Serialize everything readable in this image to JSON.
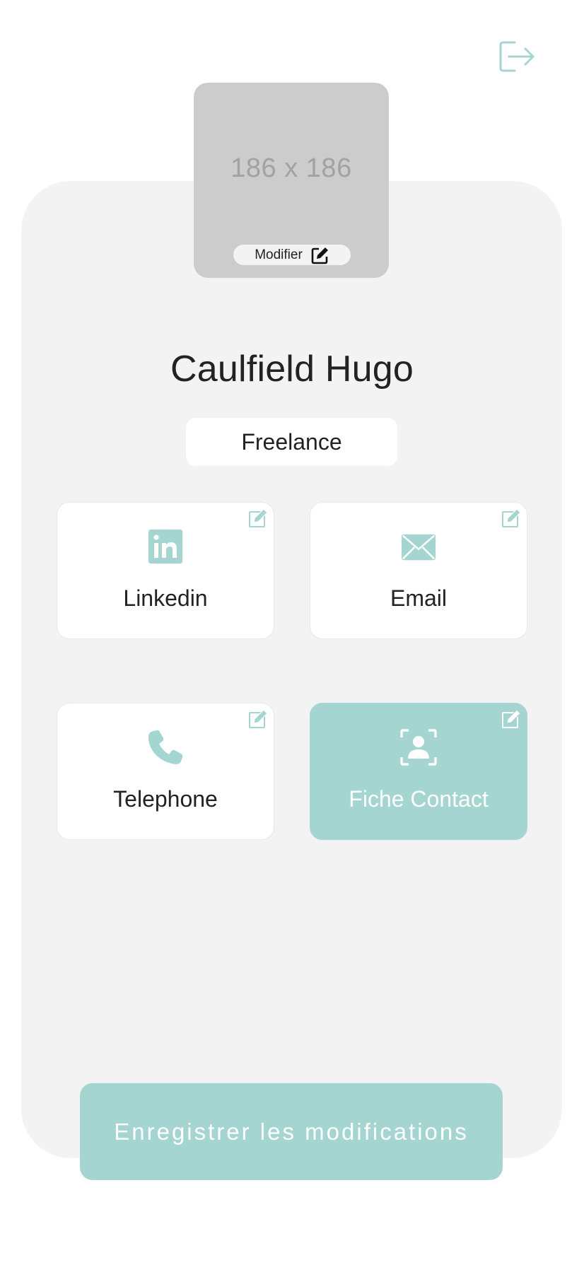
{
  "colors": {
    "accent": "#a5d5d1",
    "card_bg": "#f3f3f3",
    "placeholder_bg": "#cccccc",
    "text": "#222222"
  },
  "header": {
    "logout_icon": "logout-icon"
  },
  "profile": {
    "avatar_placeholder": "186 x 186",
    "modify_label": "Modifier",
    "name": "Caulfield Hugo",
    "status": "Freelance"
  },
  "tiles": [
    {
      "label": "Linkedin",
      "icon": "linkedin-icon",
      "active": false
    },
    {
      "label": "Email",
      "icon": "envelope-icon",
      "active": false
    },
    {
      "label": "Telephone",
      "icon": "phone-icon",
      "active": false
    },
    {
      "label": "Fiche Contact",
      "icon": "contact-card-icon",
      "active": true
    }
  ],
  "actions": {
    "save_label": "Enregistrer les modifications"
  }
}
